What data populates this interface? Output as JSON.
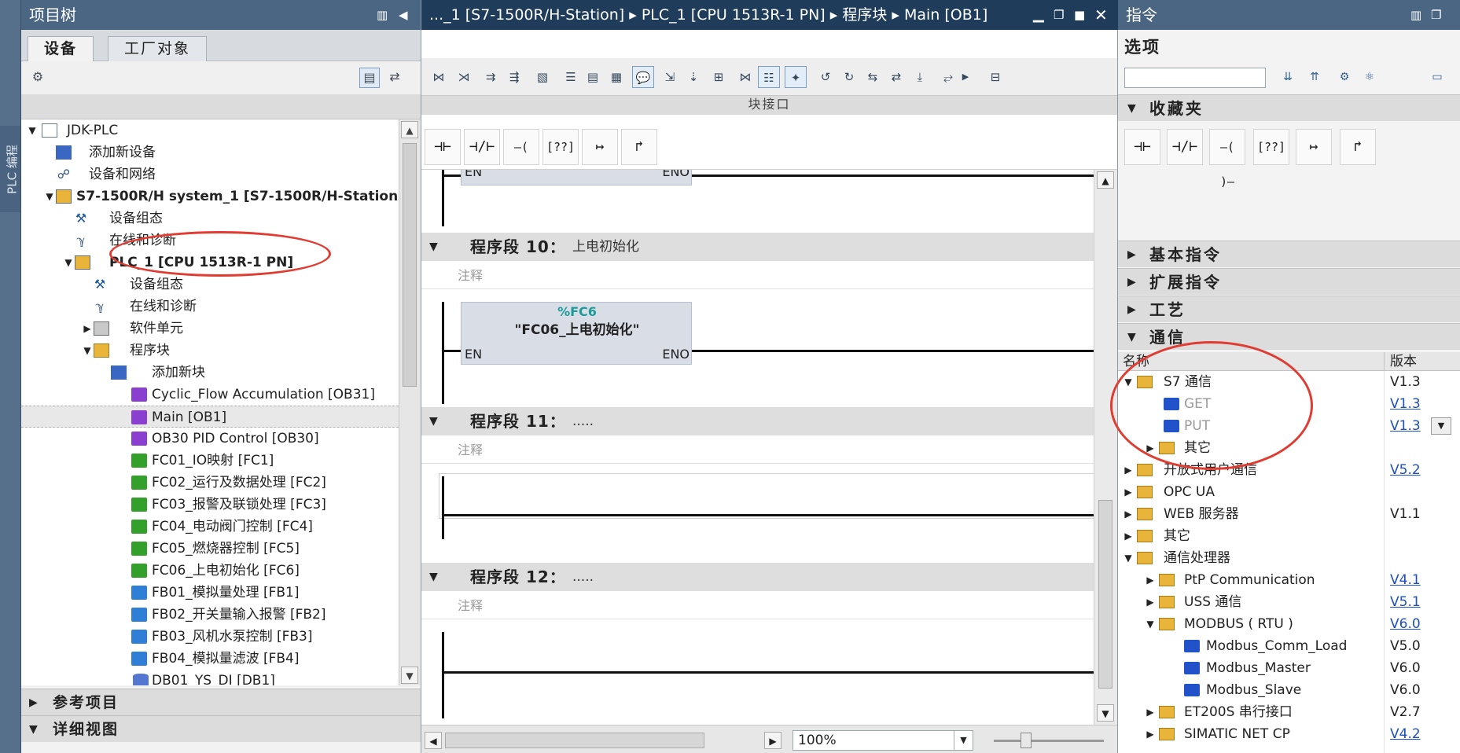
{
  "left_strip": {
    "label": "PLC 编程"
  },
  "tree": {
    "title": "项目树",
    "tabs": [
      {
        "label": "设备"
      },
      {
        "label": "工厂对象"
      }
    ],
    "items": [
      {
        "label": "JDK-PLC"
      },
      {
        "label": "添加新设备"
      },
      {
        "label": "设备和网络"
      },
      {
        "label": "S7-1500R/H system_1 [S7-1500R/H-Station]"
      },
      {
        "label": "设备组态"
      },
      {
        "label": "在线和诊断"
      },
      {
        "label": "PLC_1 [CPU 1513R-1 PN]"
      },
      {
        "label": "设备组态"
      },
      {
        "label": "在线和诊断"
      },
      {
        "label": "软件单元"
      },
      {
        "label": "程序块"
      },
      {
        "label": "添加新块"
      },
      {
        "label": "Cyclic_Flow Accumulation [OB31]"
      },
      {
        "label": "Main [OB1]"
      },
      {
        "label": "OB30 PID Control [OB30]"
      },
      {
        "label": "FC01_IO映射 [FC1]"
      },
      {
        "label": "FC02_运行及数据处理 [FC2]"
      },
      {
        "label": "FC03_报警及联锁处理 [FC3]"
      },
      {
        "label": "FC04_电动阀门控制 [FC4]"
      },
      {
        "label": "FC05_燃烧器控制 [FC5]"
      },
      {
        "label": "FC06_上电初始化 [FC6]"
      },
      {
        "label": "FB01_模拟量处理 [FB1]"
      },
      {
        "label": "FB02_开关量输入报警 [FB2]"
      },
      {
        "label": "FB03_风机水泵控制 [FB3]"
      },
      {
        "label": "FB04_模拟量滤波 [FB4]"
      },
      {
        "label": "DB01_YS_DI [DB1]"
      }
    ],
    "ref_projects": "参考项目",
    "details_view": "详细视图"
  },
  "editor": {
    "title": "..._1 [S7-1500R/H-Station] ▸ PLC_1 [CPU 1513R-1 PN] ▸ 程序块 ▸ Main [OB1]",
    "interface_label": "块接口",
    "en": "EN",
    "eno": "ENO",
    "networks": [
      {
        "title": "程序段 10：",
        "subtitle": "上电初始化",
        "comment": "注释",
        "fc_number": "%FC6",
        "fc_name": "\"FC06_上电初始化\""
      },
      {
        "title": "程序段 11：",
        "subtitle": ".....",
        "comment": "注释"
      },
      {
        "title": "程序段 12：",
        "subtitle": ".....",
        "comment": "注释"
      }
    ],
    "zoom": "100%"
  },
  "instructions": {
    "title": "指令",
    "options_label": "选项",
    "search_placeholder": "",
    "sections": {
      "favorites": "收藏夹",
      "basic": "基本指令",
      "extended": "扩展指令",
      "technology": "工艺",
      "communication": "通信"
    },
    "table": {
      "col_name": "名称",
      "col_version": "版本",
      "rows": [
        {
          "name": "S7 通信",
          "version": "V1.3"
        },
        {
          "name": "GET",
          "version": "V1.3"
        },
        {
          "name": "PUT",
          "version": "V1.3"
        },
        {
          "name": "其它",
          "version": ""
        },
        {
          "name": "开放式用户通信",
          "version": "V5.2"
        },
        {
          "name": "OPC UA",
          "version": ""
        },
        {
          "name": "WEB 服务器",
          "version": "V1.1"
        },
        {
          "name": "其它",
          "version": ""
        },
        {
          "name": "通信处理器",
          "version": ""
        },
        {
          "name": "PtP Communication",
          "version": "V4.1"
        },
        {
          "name": "USS 通信",
          "version": "V5.1"
        },
        {
          "name": "MODBUS ( RTU )",
          "version": "V6.0"
        },
        {
          "name": "Modbus_Comm_Load",
          "version": "V5.0"
        },
        {
          "name": "Modbus_Master",
          "version": "V6.0"
        },
        {
          "name": "Modbus_Slave",
          "version": "V6.0"
        },
        {
          "name": "ET200S 串行接口",
          "version": "V2.7"
        },
        {
          "name": "SIMATIC NET CP",
          "version": "V4.2"
        }
      ]
    }
  },
  "ladder_buttons": [
    "⊣⊢",
    "⊣/⊢",
    "–( )–",
    "[??]",
    "↦",
    "↱"
  ],
  "colors": {
    "title_bar": "#4b6683",
    "editor_title": "#1f3d5b",
    "annotation": "#e03c31",
    "link": "#1d4fbf",
    "fc_number": "#1f9a9a"
  }
}
